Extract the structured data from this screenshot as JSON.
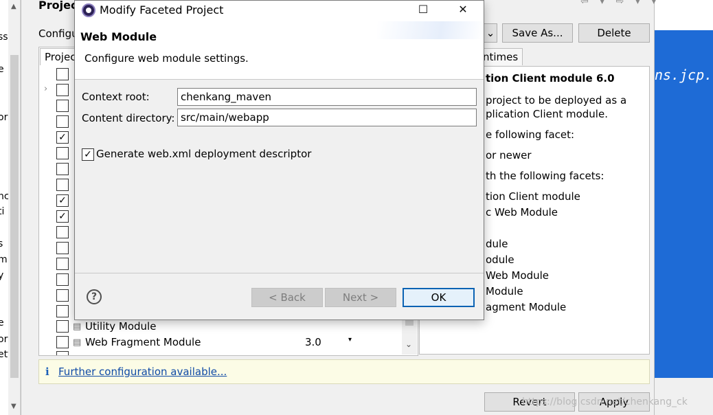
{
  "left_strip": {
    "fragments": [
      "ss",
      "e",
      "or",
      "nc",
      "ti",
      "s",
      "m",
      "y",
      "e",
      "or",
      "ett"
    ]
  },
  "editor": {
    "code_text": "ns.jcp."
  },
  "background_dialog": {
    "title": "Project",
    "config_label": "Configu",
    "save_as_label": "Save As...",
    "delete_label": "Delete",
    "facet_tab_label": "Projec",
    "runtimes_tab_label": "ntimes",
    "facet_rows": [
      {
        "label": "Utility Module",
        "version": ""
      },
      {
        "label": "Web Fragment Module",
        "version": "3.0"
      }
    ],
    "description": {
      "title": "tion Client module 6.0",
      "lines": [
        "project to be deployed as a",
        "plication Client module.",
        "e following facet:",
        "or newer",
        "th the following facets:",
        "tion Client module",
        "c Web Module",
        "dule",
        "odule",
        "Web Module",
        "Module",
        "agment Module"
      ]
    },
    "info_text": "Further configuration available...",
    "revert_label": "Revert",
    "apply_label": "Apply"
  },
  "modal": {
    "title": "Modify Faceted Project",
    "section_title": "Web Module",
    "section_desc": "Configure web module settings.",
    "context_root_label": "Context root:",
    "context_root_value": "chenkang_maven",
    "content_dir_label": "Content directory:",
    "content_dir_value": "src/main/webapp",
    "generate_label": "Generate web.xml deployment descriptor",
    "generate_checked": true,
    "back_label": "< Back",
    "next_label": "Next >",
    "ok_label": "OK",
    "help_symbol": "?"
  },
  "watermark": "https://blog.csdn.net/chenkang_ck"
}
